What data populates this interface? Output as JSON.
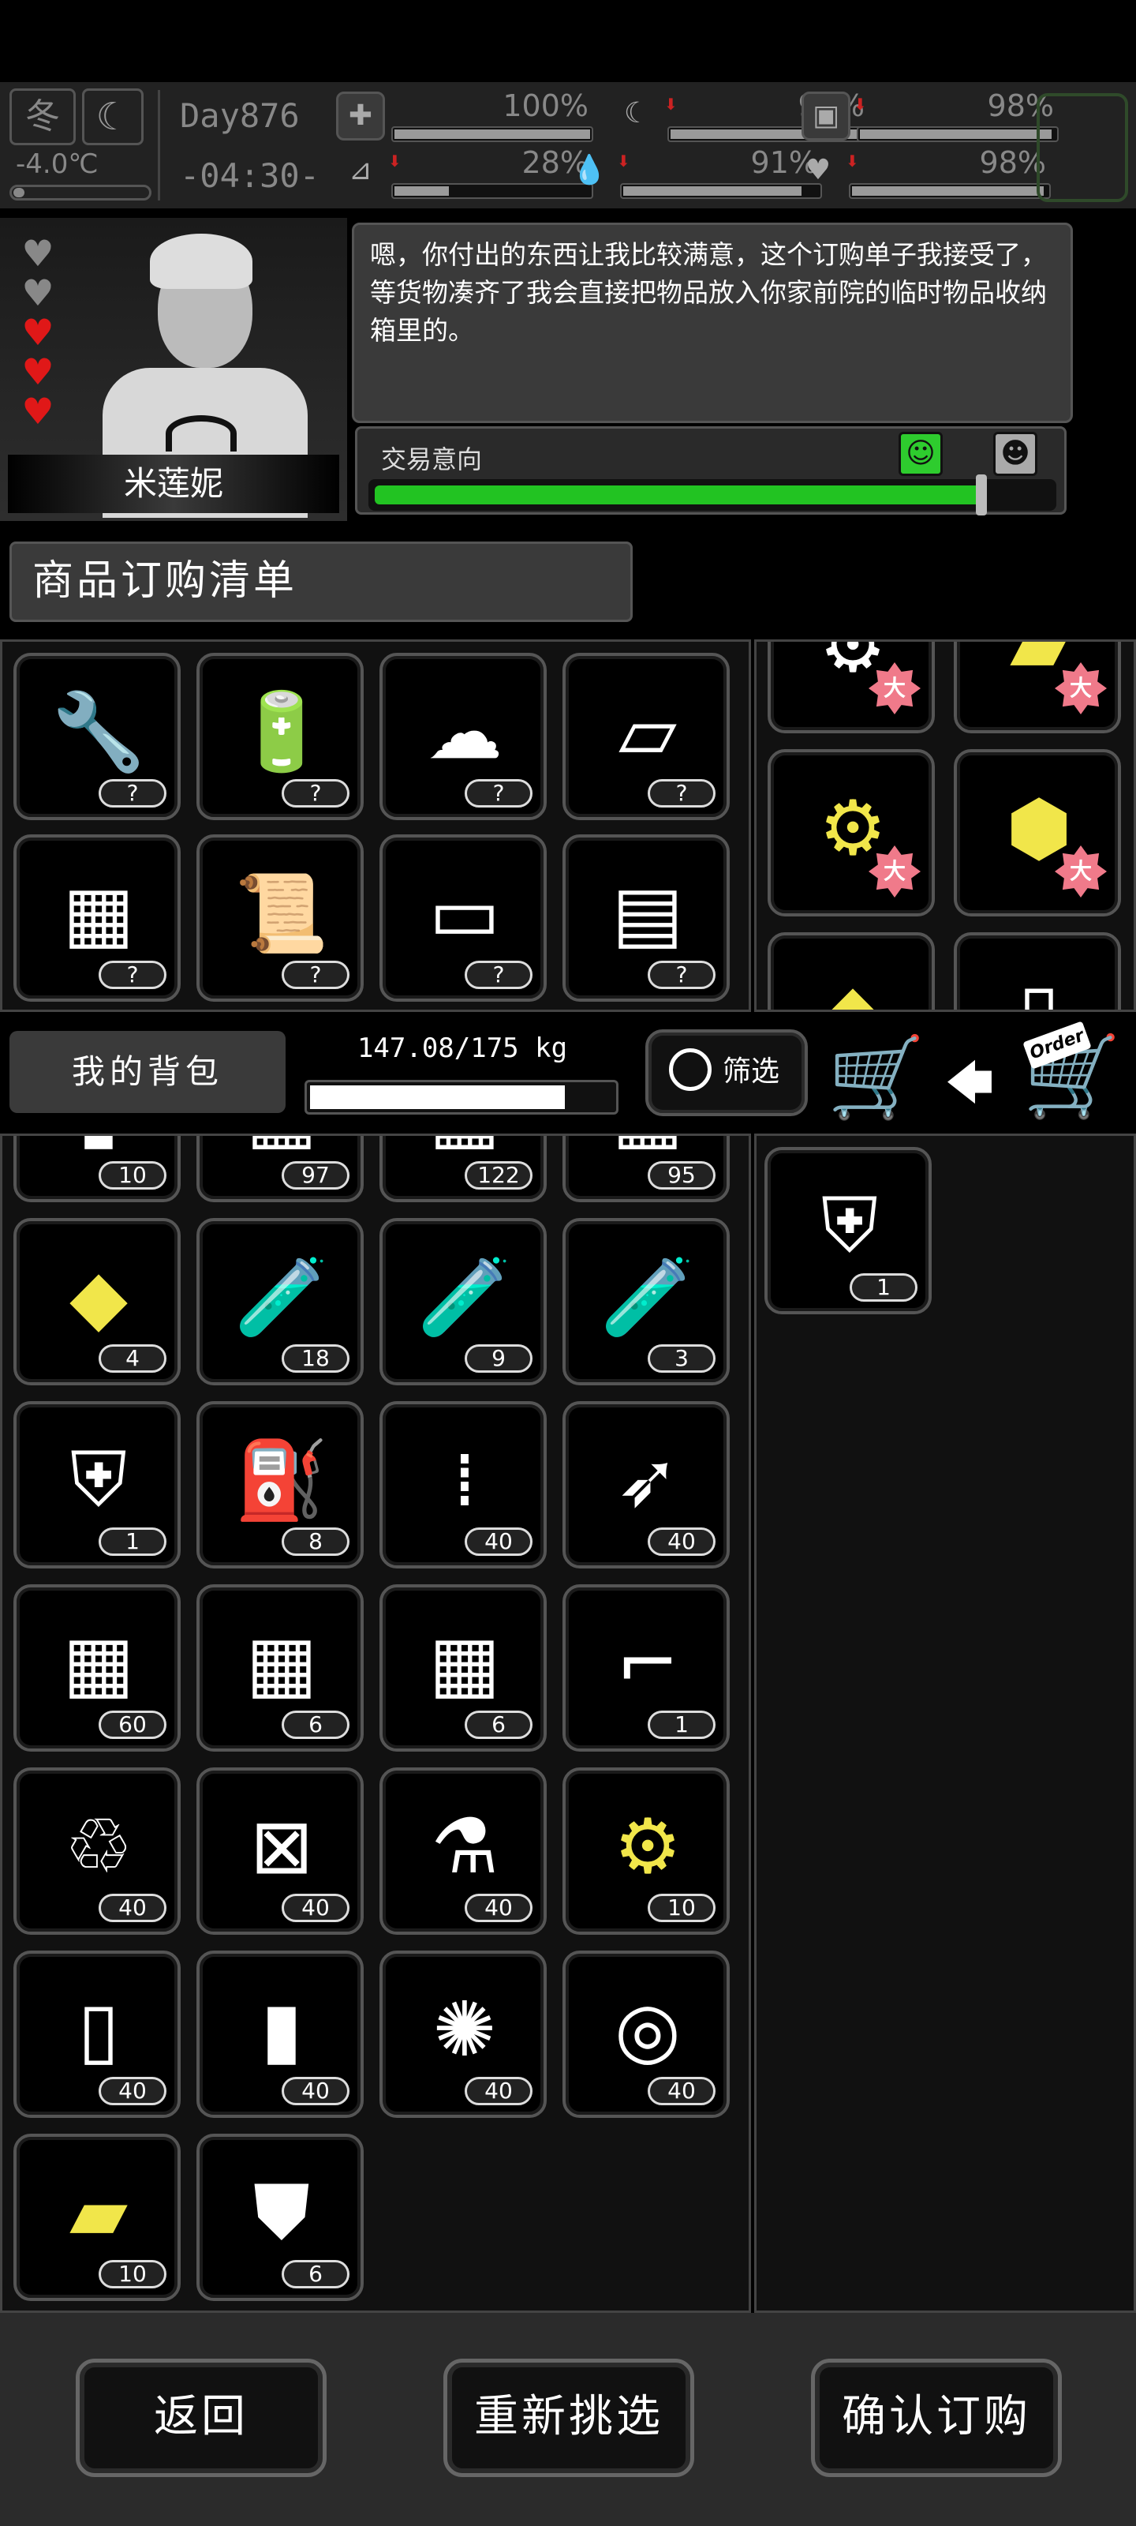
{
  "status": {
    "season": "冬",
    "temperature": "-4.0℃",
    "day": "Day876",
    "time": "-04:30-",
    "stats": [
      {
        "name": "health",
        "icon": "medkit-icon",
        "value": "100%",
        "level": 1.0,
        "glyph": "✚"
      },
      {
        "name": "hunger",
        "icon": "stomach-icon",
        "value": "96%",
        "level": 0.96,
        "glyph": "☾"
      },
      {
        "name": "stamina",
        "icon": "canister-icon",
        "value": "98%",
        "level": 0.98,
        "glyph": "▣"
      },
      {
        "name": "leg",
        "icon": "leg-icon",
        "value": "28%",
        "level": 0.28,
        "glyph": "⊿"
      },
      {
        "name": "thirst",
        "icon": "water-drop-icon",
        "value": "91%",
        "level": 0.91,
        "glyph": "💧"
      },
      {
        "name": "mood",
        "icon": "heart-icon",
        "value": "98%",
        "level": 0.98,
        "glyph": "♥"
      }
    ]
  },
  "npc": {
    "name": "米莲妮",
    "affection": {
      "filled": 3,
      "total": 5
    },
    "speech": "嗯，你付出的东西让我比较满意，这个订购单子我接受了，等货物凑齐了我会直接把物品放入你家前院的临时物品收纳箱里的。",
    "intent_label": "交易意向",
    "intent_level": 0.9
  },
  "order": {
    "title": "商品订购清单",
    "items": [
      {
        "icon": "pliers-tool-icon",
        "glyph": "🔧",
        "count": "?"
      },
      {
        "icon": "battery-icon",
        "glyph": "🔋",
        "count": "?"
      },
      {
        "icon": "cotton-balls-icon",
        "glyph": "☁",
        "count": "?"
      },
      {
        "icon": "cloth-icon",
        "glyph": "▱",
        "count": "?"
      },
      {
        "icon": "wood-planks-icon",
        "glyph": "▦",
        "count": "?"
      },
      {
        "icon": "paper-roll-icon",
        "glyph": "📜",
        "count": "?"
      },
      {
        "icon": "towel-icon",
        "glyph": "▭",
        "count": "?"
      },
      {
        "icon": "bricks-icon",
        "glyph": "▤",
        "count": "?"
      }
    ],
    "offer_items": [
      {
        "icon": "gears-icon",
        "glyph": "⚙",
        "yellow": false,
        "badge": "大"
      },
      {
        "icon": "gold-bars-icon",
        "glyph": "▰",
        "yellow": true,
        "badge": "大"
      },
      {
        "icon": "gears-icon",
        "glyph": "⚙",
        "yellow": true,
        "badge": "大"
      },
      {
        "icon": "gold-ingot-icon",
        "glyph": "⬢",
        "yellow": true,
        "badge": "大"
      },
      {
        "icon": "gold-nuggets-icon",
        "glyph": "◆",
        "yellow": true,
        "badge": ""
      },
      {
        "icon": "jerry-can-icon",
        "glyph": "▯",
        "yellow": false,
        "badge": ""
      }
    ]
  },
  "backpack": {
    "label": "我的背包",
    "weight": "147.08/175 kg",
    "weight_fraction": 0.84,
    "filter_label": "筛选",
    "items": [
      {
        "icon": "bottle-icon",
        "glyph": "▮",
        "count": "10",
        "yellow": false
      },
      {
        "icon": "crate-icon",
        "glyph": "▦",
        "count": "97",
        "yellow": false
      },
      {
        "icon": "crate-icon",
        "glyph": "▦",
        "count": "122",
        "yellow": false
      },
      {
        "icon": "crate-icon",
        "glyph": "▦",
        "count": "95",
        "yellow": false
      },
      {
        "icon": "gold-ore-icon",
        "glyph": "◆",
        "count": "4",
        "yellow": true
      },
      {
        "icon": "test-tube-vii-icon",
        "glyph": "🧪",
        "count": "18",
        "yellow": false
      },
      {
        "icon": "test-tube-vi-icon",
        "glyph": "🧪",
        "count": "9",
        "yellow": false
      },
      {
        "icon": "test-tube-v-icon",
        "glyph": "🧪",
        "count": "3",
        "yellow": false
      },
      {
        "icon": "body-armor-icon",
        "glyph": "⛨",
        "count": "1",
        "yellow": false
      },
      {
        "icon": "spray-cans-icon",
        "glyph": "⛽",
        "count": "8",
        "yellow": false
      },
      {
        "icon": "bullets-icon",
        "glyph": "⁞",
        "count": "40",
        "yellow": false
      },
      {
        "icon": "rocket-icon",
        "glyph": "➶",
        "count": "40",
        "yellow": false
      },
      {
        "icon": "crate-i-icon",
        "glyph": "▦",
        "count": "60",
        "yellow": false
      },
      {
        "icon": "crate-v-icon",
        "glyph": "▦",
        "count": "6",
        "yellow": false
      },
      {
        "icon": "crate-special-icon",
        "glyph": "▦",
        "count": "6",
        "yellow": false
      },
      {
        "icon": "rifle-icon",
        "glyph": "⌐",
        "count": "1",
        "yellow": false
      },
      {
        "icon": "crushed-bottles-icon",
        "glyph": "♲",
        "count": "40",
        "yellow": false
      },
      {
        "icon": "broken-canister-icon",
        "glyph": "⊠",
        "count": "40",
        "yellow": false
      },
      {
        "icon": "flask-icon",
        "glyph": "⚗",
        "count": "40",
        "yellow": false
      },
      {
        "icon": "gears-icon",
        "glyph": "⚙",
        "count": "10",
        "yellow": true
      },
      {
        "icon": "jerry-can-icon",
        "glyph": "▯",
        "count": "40",
        "yellow": false
      },
      {
        "icon": "glass-bottle-icon",
        "glyph": "▮",
        "count": "40",
        "yellow": false
      },
      {
        "icon": "fiber-ball-icon",
        "glyph": "✺",
        "count": "40",
        "yellow": false
      },
      {
        "icon": "logs-icon",
        "glyph": "◎",
        "count": "40",
        "yellow": false
      },
      {
        "icon": "gold-plate-icon",
        "glyph": "▰",
        "count": "10",
        "yellow": true
      },
      {
        "icon": "riot-shield-icon",
        "glyph": "⛊",
        "count": "6",
        "yellow": false
      }
    ],
    "offer": [
      {
        "icon": "body-armor-icon",
        "glyph": "⛨",
        "count": "1",
        "yellow": false
      }
    ]
  },
  "buttons": {
    "back": "返回",
    "reselect": "重新挑选",
    "confirm": "确认订购"
  },
  "colors": {
    "accent_green": "#22c322",
    "item_yellow": "#f1e64a",
    "heart_red": "#e01818"
  }
}
